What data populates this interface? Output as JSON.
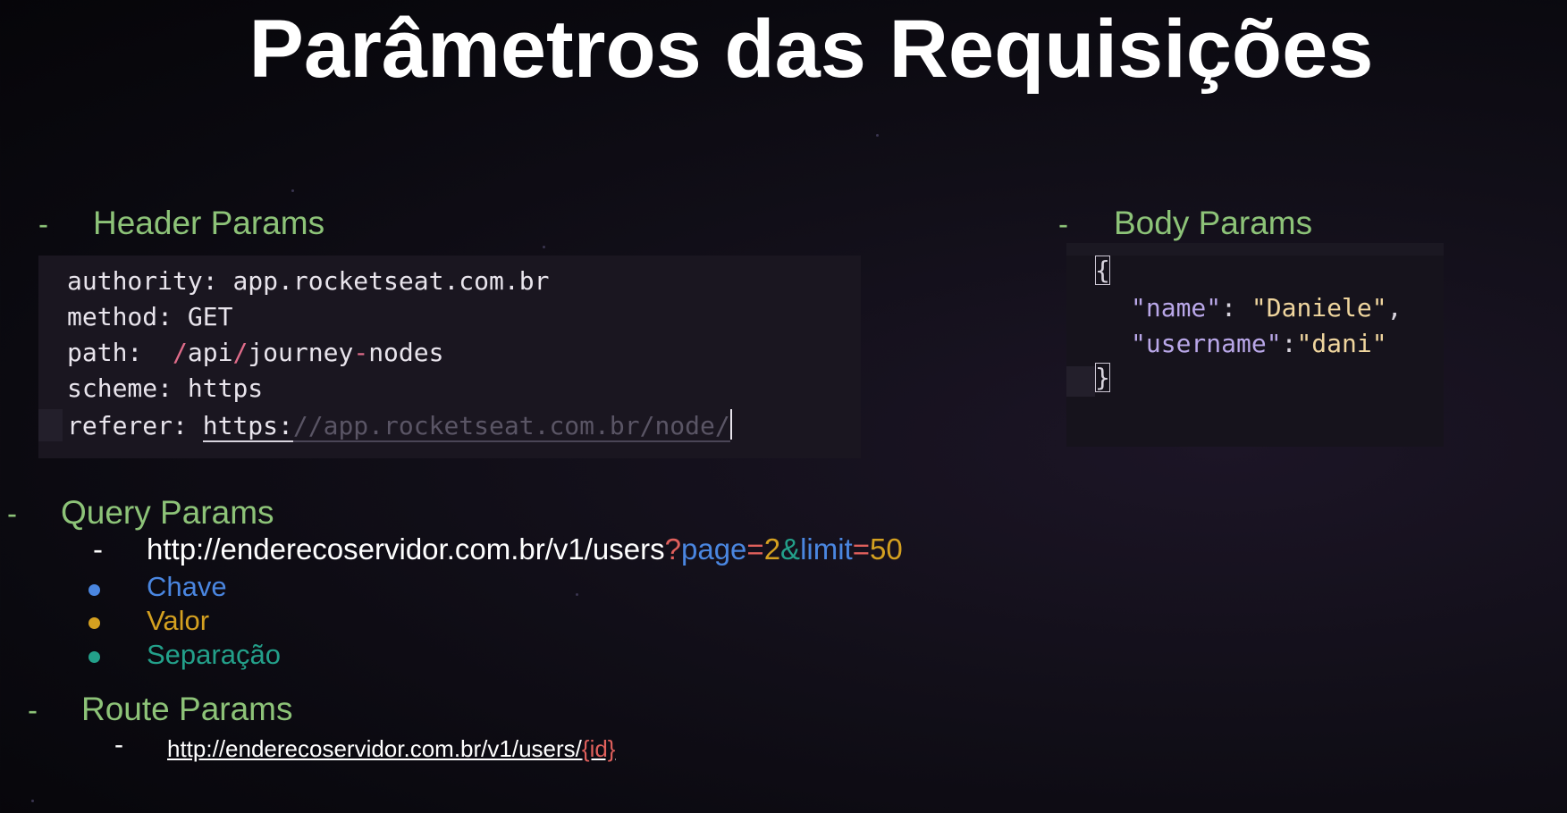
{
  "title": "Parâmetros das Requisições",
  "sections": {
    "header_params": {
      "dash": "-",
      "title": "Header Params",
      "lines": [
        {
          "key": "authority:",
          "value": "app.rocketseat.com.br"
        },
        {
          "key": "method:",
          "value": "GET"
        },
        {
          "key": "path:",
          "value_parts": [
            "/",
            "api",
            "/",
            "journey",
            "-",
            "nodes"
          ]
        },
        {
          "key": "scheme:",
          "value": "https"
        },
        {
          "key": "referer:",
          "value_scheme": "https:",
          "value_rest": "//app.rocketseat.com.br/node/"
        }
      ]
    },
    "body_params": {
      "dash": "-",
      "title": "Body Params",
      "open_brace": "{",
      "close_brace": "}",
      "fields": [
        {
          "key": "\"name\"",
          "sep": ":",
          "value": "\"Daniele\"",
          "trail": ","
        },
        {
          "key": "\"username\"",
          "sep": ":",
          "value": "\"dani\"",
          "trail": ""
        }
      ]
    },
    "query_params": {
      "dash": "-",
      "title": "Query Params",
      "url_dash": "-",
      "url_base": "http://enderecoservidor.com.br/v1/users",
      "url_q": "?",
      "key1": "page",
      "eq1": "=",
      "val1": "2",
      "amp": "&",
      "key2": "limit",
      "eq2": "=",
      "val2": "50",
      "legend": [
        {
          "label": "Chave",
          "color": "#4a86e0"
        },
        {
          "label": "Valor",
          "color": "#d4a020"
        },
        {
          "label": "Separação",
          "color": "#23a08a"
        }
      ]
    },
    "route_params": {
      "dash": "-",
      "title": "Route Params",
      "url_dash": "-",
      "url_base": "http://enderecoservidor.com.br/v1/users/",
      "url_param": "{id}"
    }
  }
}
